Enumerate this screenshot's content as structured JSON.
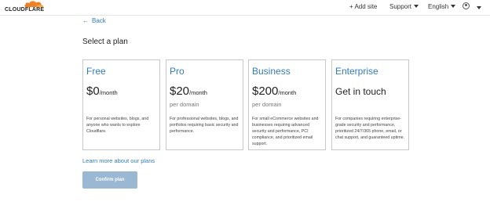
{
  "header": {
    "logo_text": "CLOUDFLARE",
    "add_site": "+ Add site",
    "support": "Support",
    "language": "English"
  },
  "back_label": "Back",
  "page_title": "Select a plan",
  "plans": [
    {
      "name": "Free",
      "price": "$0",
      "per": "/month",
      "sub": "",
      "description": "For personal websites, blogs, and anyone who wants to explore Cloudflare."
    },
    {
      "name": "Pro",
      "price": "$20",
      "per": "/month",
      "sub": "per domain",
      "description": "For professional websites, blogs, and portfolios requiring basic security and performance."
    },
    {
      "name": "Business",
      "price": "$200",
      "per": "/month",
      "sub": "per domain",
      "description": "For small eCommerce websites and businesses requiring advanced security and performance, PCI compliance, and prioritized email support."
    },
    {
      "name": "Enterprise",
      "price": "Get in touch",
      "description": "For companies requiring enterprise-grade security and performance, prioritized 24/7/365 phone, email, or chat support, and guaranteed uptime."
    }
  ],
  "learn_more": "Learn more about our plans",
  "confirm_label": "Confirm plan",
  "colors": {
    "accent": "#2f7bbf",
    "logo_orange": "#f38020",
    "confirm_disabled": "#9ab8d4"
  }
}
